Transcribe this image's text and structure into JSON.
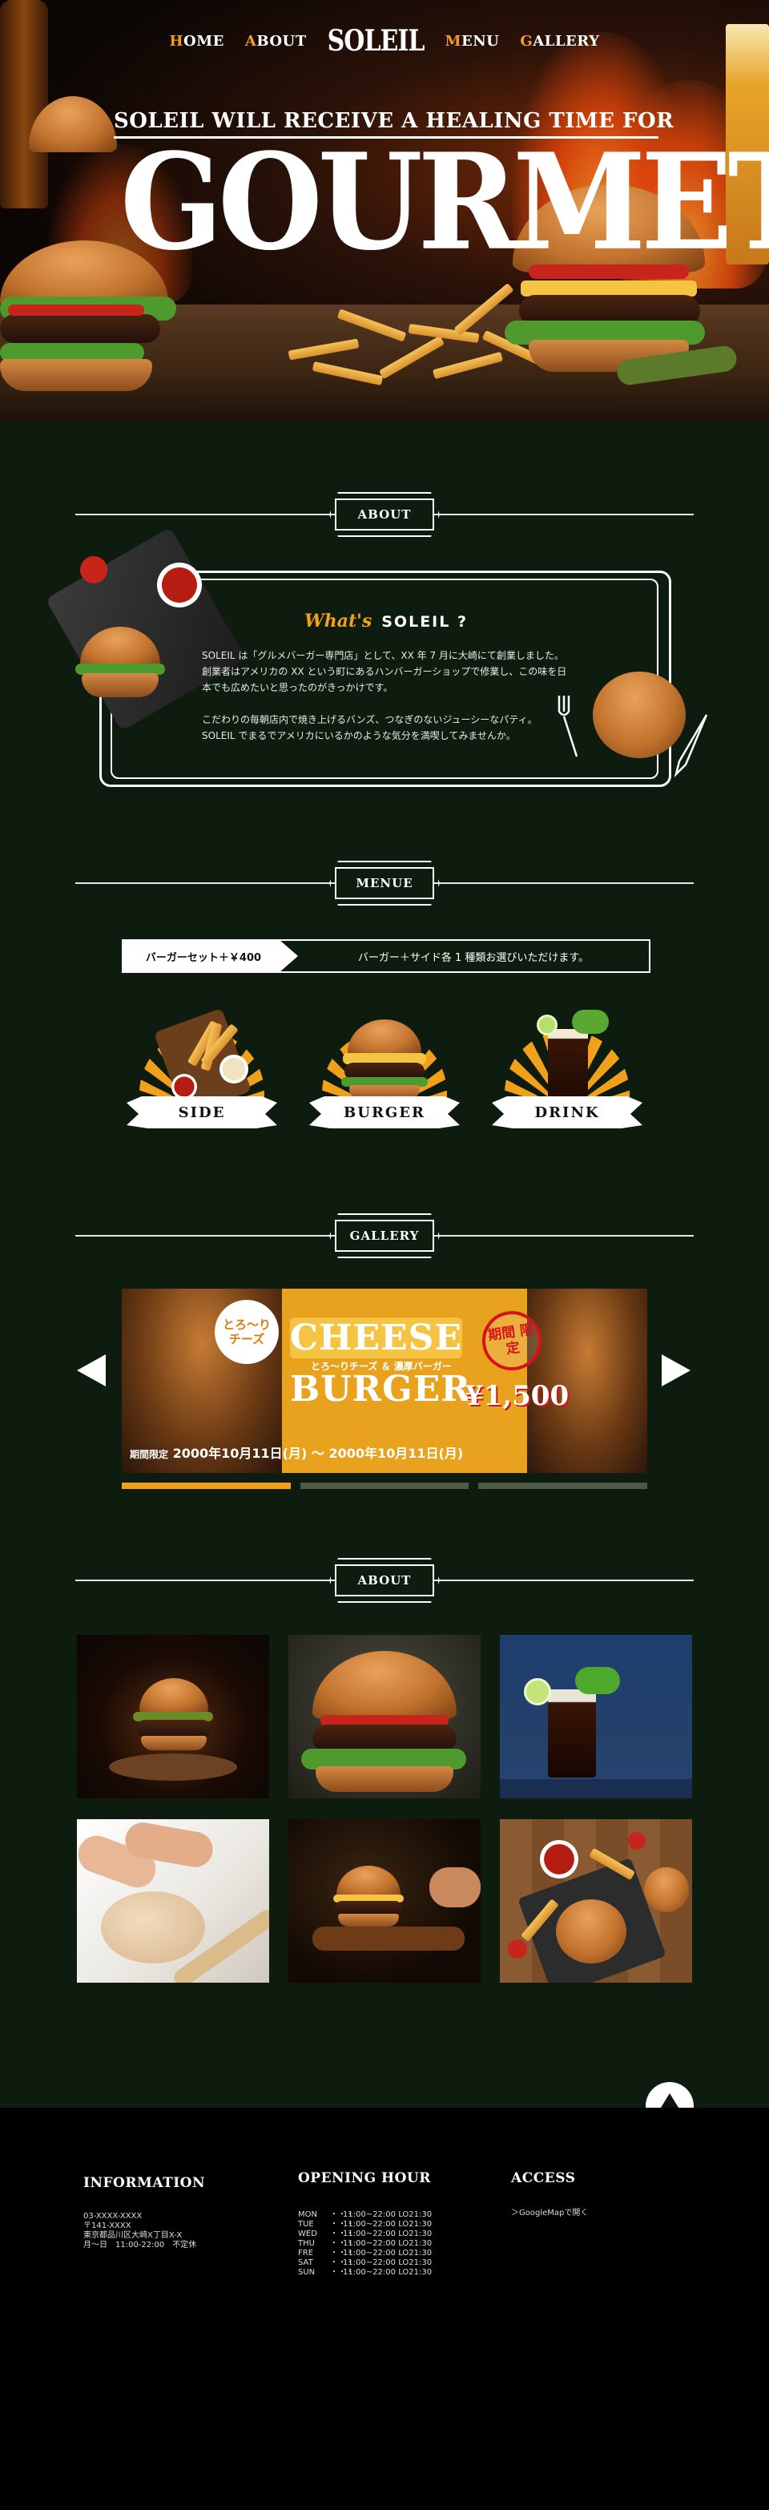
{
  "nav": {
    "home": {
      "first": "H",
      "rest": "OME"
    },
    "about": {
      "first": "A",
      "rest": "BOUT"
    },
    "logo": "SOLEIL",
    "menu": {
      "first": "M",
      "rest": "ENU"
    },
    "gallery": {
      "first": "G",
      "rest": "ALLERY"
    }
  },
  "hero": {
    "tagline": "SOLEIL WILL RECEIVE A HEALING TIME FOR YOU",
    "headline": "GOURMET"
  },
  "about_section": {
    "heading": "ABOUT",
    "whats": "What's",
    "name": "SOLEIL ?",
    "paragraph1": "SOLEIL は「グルメバーガー専門店」として、XX 年 7 月に大崎にて創業しました。創業者はアメリカの XX という町にあるハンバーガーショップで修業し、この味を日本でも広めたいと思ったのがきっかけです。",
    "paragraph2": "こだわりの毎朝店内で焼き上げるバンズ、つなぎのないジューシーなパティ。SOLEIL でまるでアメリカにいるかのような気分を満喫してみませんか。"
  },
  "menu_section": {
    "heading": "MENUE",
    "set_label": "バーガーセット＋￥400",
    "set_note": "バーガー＋サイド各 1 種類お選びいただけます。",
    "items": [
      {
        "label": "SIDE"
      },
      {
        "label": "BURGER"
      },
      {
        "label": "DRINK"
      }
    ]
  },
  "gallery_section": {
    "heading": "GALLERY",
    "slide": {
      "bubble": "とろ〜り チーズ",
      "title1": "CHEESE",
      "subtitle": "とろ〜りチーズ ＆ 濃厚バーガー",
      "title2": "BURGER",
      "limited": "期間 限定",
      "price": "¥1,500",
      "period_prefix": "期間限定",
      "period_start": "2000年10月11日(月)",
      "period_sep": "〜",
      "period_end": "2000年10月11日(月)"
    },
    "active_slide": 1,
    "slide_count": 3
  },
  "photos_section": {
    "heading": "ABOUT"
  },
  "footer": {
    "information": {
      "heading": "INFORMATION",
      "lines": [
        "03-XXXX-XXXX",
        "〒141-XXXX",
        "東京都品川区大崎X丁目X-X",
        "月〜日　11:00-22:00　不定休"
      ]
    },
    "hours": {
      "heading": "OPENING HOUR",
      "sep": "・・・",
      "rows": [
        {
          "day": "MON",
          "time": "11:00~22:00 LO21:30"
        },
        {
          "day": "TUE",
          "time": "11:00~22:00 LO21:30"
        },
        {
          "day": "WED",
          "time": "11:00~22:00 LO21:30"
        },
        {
          "day": "THU",
          "time": "11:00~22:00 LO21:30"
        },
        {
          "day": "FRE",
          "time": "11:00~22:00 LO21:30"
        },
        {
          "day": "SAT",
          "time": "11:00~22:00 LO21:30"
        },
        {
          "day": "SUN",
          "time": "11:00~22:00 LO21:30"
        }
      ]
    },
    "access": {
      "heading": "ACCESS",
      "link": "＞GoogleMapで開く"
    }
  },
  "colors": {
    "accent": "#f0a019",
    "main_bg": "#0e1c10",
    "footer_bg": "#000000",
    "sale_red": "#d4141a"
  }
}
